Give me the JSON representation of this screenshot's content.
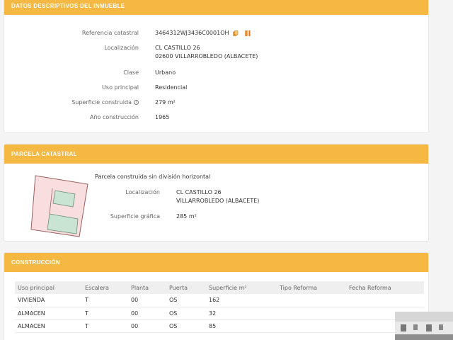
{
  "datos": {
    "title": "DATOS DESCRIPTIVOS DEL INMUEBLE",
    "rows": [
      {
        "label": "Referencia catastral",
        "value": "3464312WJ3436C0001OH"
      },
      {
        "label": "Localización",
        "value": "CL CASTILLO 26",
        "value2": "02600 VILLARROBLEDO (ALBACETE)"
      },
      {
        "label": "Clase",
        "value": "Urbano"
      },
      {
        "label": "Uso principal",
        "value": "Residencial"
      },
      {
        "label": "Superficie construida",
        "value": "279 m²"
      },
      {
        "label": "Año construcción",
        "value": "1965"
      }
    ],
    "icons": [
      "copy-icon",
      "barcode-icon",
      "info-icon"
    ]
  },
  "parcela": {
    "title": "PARCELA CATASTRAL",
    "subtitle": "Parcela construida sin división horizontal",
    "rows": [
      {
        "label": "Localización",
        "value": "CL CASTILLO 26",
        "value2": "VILLARROBLEDO (ALBACETE)"
      },
      {
        "label": "Superficie gráfica",
        "value": "285 m²"
      }
    ]
  },
  "construccion": {
    "title": "CONSTRUCCIÓN",
    "headers": [
      "Uso principal",
      "Escalera",
      "Planta",
      "Puerta",
      "Superficie m²",
      "Tipo Reforma",
      "Fecha Reforma"
    ],
    "rows": [
      [
        "VIVIENDA",
        "T",
        "00",
        "OS",
        "162",
        "",
        ""
      ],
      [
        "ALMACEN",
        "T",
        "00",
        "OS",
        "32",
        "",
        ""
      ],
      [
        "ALMACEN",
        "T",
        "00",
        "OS",
        "85",
        "",
        ""
      ]
    ]
  },
  "colors": {
    "header": "#f5b842",
    "parcel_fill": "#f8dede",
    "building_fill": "#c9e4d2"
  }
}
